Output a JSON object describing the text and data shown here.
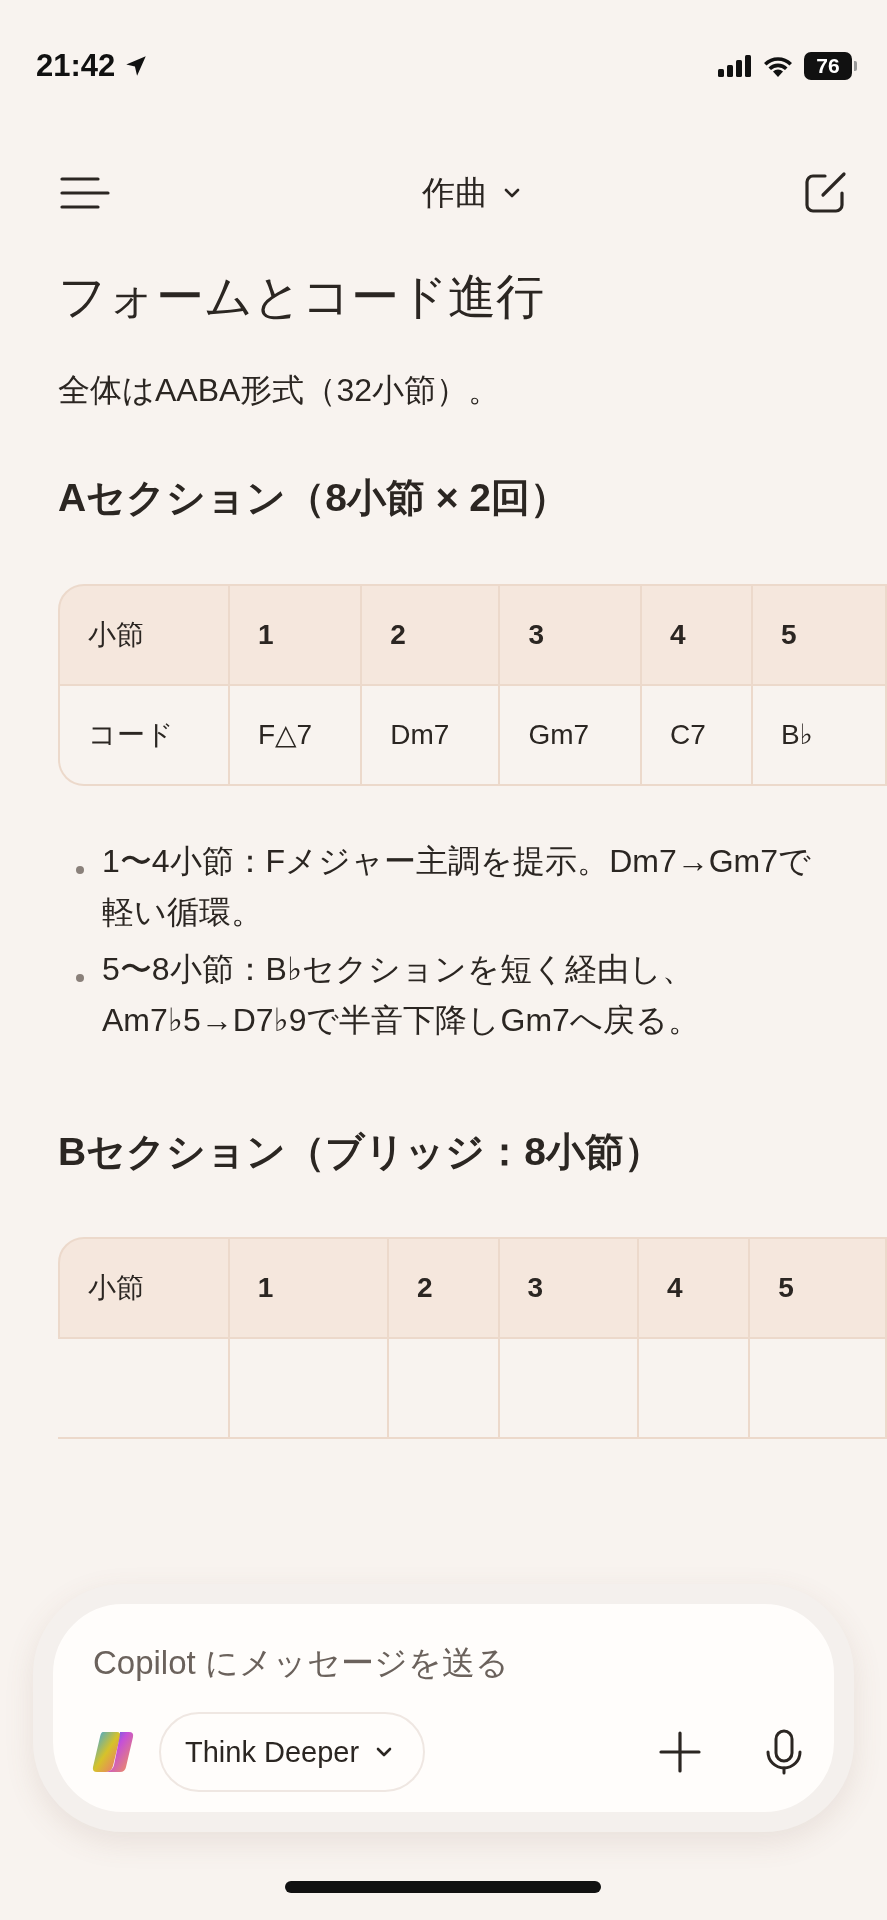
{
  "status_bar": {
    "time": "21:42",
    "battery": "76"
  },
  "nav": {
    "title": "作曲"
  },
  "content": [
    {
      "kind": "heading",
      "text": "フォームとコード進行"
    },
    {
      "kind": "paragraph",
      "text": "全体はAABA形式（32小節）。"
    },
    {
      "kind": "subheading",
      "text": "Aセクション（8小節 × 2回）"
    },
    {
      "kind": "table",
      "rows": [
        [
          "小節",
          "1",
          "2",
          "3",
          "4",
          "5"
        ],
        [
          "コード",
          "F△7",
          "Dm7",
          "Gm7",
          "C7",
          "B♭"
        ]
      ]
    },
    {
      "kind": "bullets",
      "items": [
        "1〜4小節：Fメジャー主調を提示。Dm7→Gm7で軽い循環。",
        "5〜8小節：B♭セクションを短く経由し、Am7♭5→D7♭9で半音下降しGm7へ戻る。"
      ]
    },
    {
      "kind": "subheading",
      "text": "Bセクション（ブリッジ：8小節）"
    },
    {
      "kind": "table",
      "rows": [
        [
          "小節",
          "1",
          "2",
          "3",
          "4",
          "5"
        ]
      ]
    }
  ],
  "composer": {
    "placeholder": "Copilot にメッセージを送る",
    "mode": "Think Deeper"
  }
}
